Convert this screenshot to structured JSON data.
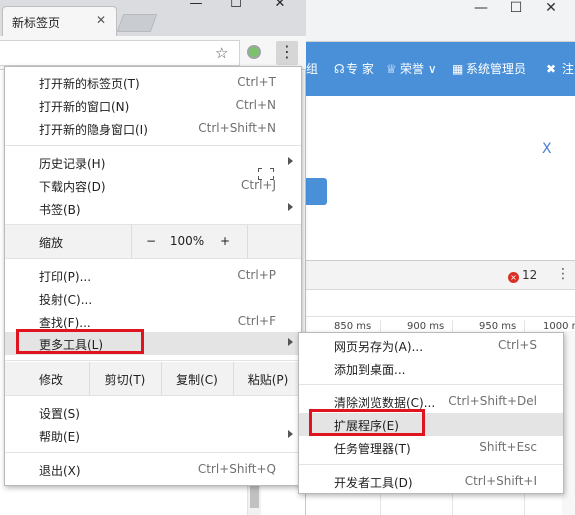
{
  "browser": {
    "tab_title": "新标签页",
    "tab_close": "✕",
    "star": "☆",
    "menu_icon": "⋮",
    "icons": [
      "close-icon",
      "star-icon",
      "extension-icon",
      "more-vert-icon",
      "fullscreen-icon",
      "chevron-right-icon",
      "error-icon"
    ]
  },
  "background": {
    "window_buttons": {
      "min": "—",
      "max": "☐",
      "close": "✕"
    },
    "app_nav": {
      "group": "组",
      "expert_icon": "☊",
      "expert": "专 家",
      "honor_icon": "♕",
      "honor": "荣誉 ∨",
      "admin_icon": "▦",
      "admin": "系统管理员",
      "logout_icon": "✖",
      "logout": "注"
    },
    "close_x": "X",
    "error_count": "12",
    "error_glyph": "×",
    "more": "⋮",
    "timeline_ticks": [
      "850 ms",
      "900 ms",
      "950 ms",
      "1000 r"
    ]
  },
  "menu": {
    "new_tab": {
      "label": "打开新的标签页(T)",
      "shortcut": "Ctrl+T"
    },
    "new_window": {
      "label": "打开新的窗口(N)",
      "shortcut": "Ctrl+N"
    },
    "incognito": {
      "label": "打开新的隐身窗口(I)",
      "shortcut": "Ctrl+Shift+N"
    },
    "history": {
      "label": "历史记录(H)"
    },
    "downloads": {
      "label": "下载内容(D)",
      "shortcut": "Ctrl+J"
    },
    "bookmarks": {
      "label": "书签(B)"
    },
    "zoom": {
      "label": "缩放",
      "minus": "−",
      "value": "100%",
      "plus": "+"
    },
    "print": {
      "label": "打印(P)...",
      "shortcut": "Ctrl+P"
    },
    "cast": {
      "label": "投射(C)..."
    },
    "find": {
      "label": "查找(F)...",
      "shortcut": "Ctrl+F"
    },
    "more_tools": {
      "label": "更多工具(L)"
    },
    "edit": {
      "label": "修改",
      "cut": "剪切(T)",
      "copy": "复制(C)",
      "paste": "粘贴(P)"
    },
    "settings": {
      "label": "设置(S)"
    },
    "help": {
      "label": "帮助(E)"
    },
    "exit": {
      "label": "退出(X)",
      "shortcut": "Ctrl+Shift+Q"
    }
  },
  "submenu": {
    "save_page": {
      "label": "网页另存为(A)...",
      "shortcut": "Ctrl+S"
    },
    "add_desktop": {
      "label": "添加到桌面..."
    },
    "clear_data": {
      "label": "清除浏览数据(C)...",
      "shortcut": "Ctrl+Shift+Del"
    },
    "extensions": {
      "label": "扩展程序(E)"
    },
    "task_manager": {
      "label": "任务管理器(T)",
      "shortcut": "Shift+Esc"
    },
    "dev_tools": {
      "label": "开发者工具(D)",
      "shortcut": "Ctrl+Shift+I"
    }
  },
  "colors": {
    "highlight_box": "#e0141e",
    "app_blue": "#4a90d9"
  }
}
